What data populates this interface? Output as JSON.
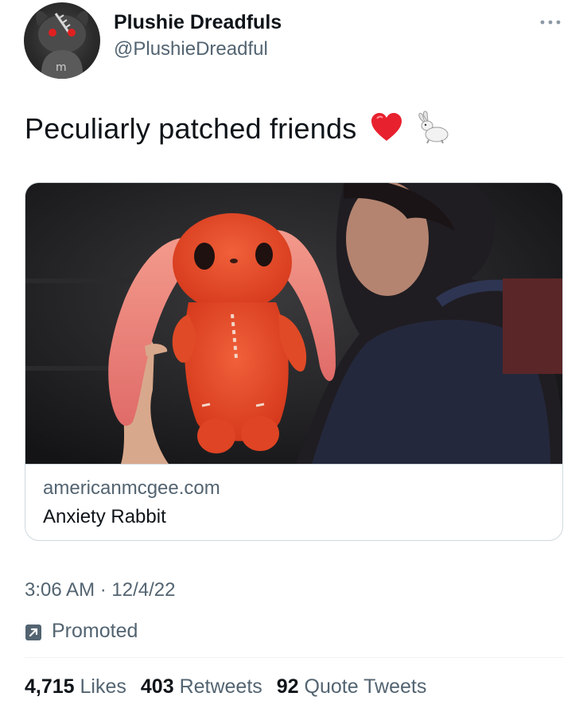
{
  "author": {
    "display_name": "Plushie Dreadfuls",
    "handle": "@PlushieDreadful",
    "avatar_icon": "plush-avatar-icon"
  },
  "more_icon": "more-horizontal-icon",
  "tweet": {
    "text": "Peculiarly patched friends",
    "emojis": [
      "red-heart-icon",
      "rabbit-icon"
    ]
  },
  "card": {
    "domain": "americanmcgee.com",
    "title": "Anxiety Rabbit"
  },
  "meta": {
    "timestamp": "3:06 AM · 12/4/22",
    "promoted_label": "Promoted",
    "promoted_icon": "promoted-arrow-icon"
  },
  "stats": [
    {
      "count": "4,715",
      "label": "Likes"
    },
    {
      "count": "403",
      "label": "Retweets"
    },
    {
      "count": "92",
      "label": "Quote Tweets"
    }
  ],
  "colors": {
    "text_primary": "#0f1419",
    "text_secondary": "#536471",
    "border": "#cfd9de",
    "heart": "#e0245e",
    "plush": "#e2482a"
  }
}
